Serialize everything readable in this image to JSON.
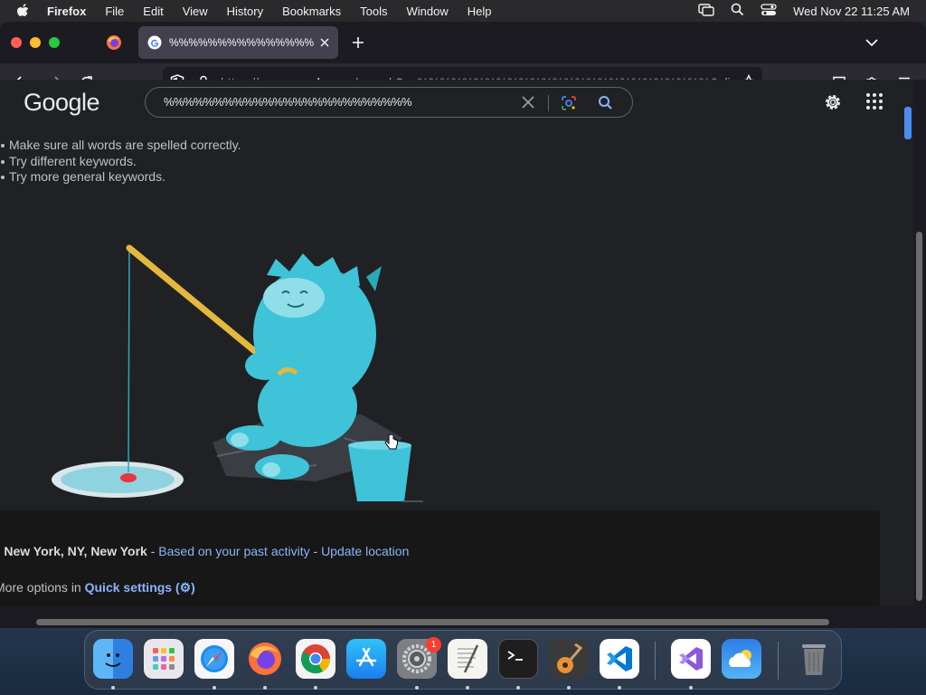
{
  "menubar": {
    "app_name": "Firefox",
    "items": [
      "File",
      "Edit",
      "View",
      "History",
      "Bookmarks",
      "Tools",
      "Window",
      "Help"
    ],
    "datetime": "Wed Nov 22  11:25 AM"
  },
  "browser": {
    "active_tab_title": "%%%%%%%%%%%%%%%%%%%%%%%%%%% -",
    "url_prefix": "https://",
    "url_host": "www.google.com",
    "url_rest": "/search?q=%%%%%%%%%%%%%%%%%%%%%%%%%%&client=firefox-b-1-d&"
  },
  "google": {
    "logo_text": "Google",
    "search_query": "%%%%%%%%%%%%%%%%%%%%%%%%%"
  },
  "tips": [
    "Make sure all words are spelled correctly.",
    "Try different keywords.",
    "Try more general keywords."
  ],
  "footer": {
    "location": "New York, NY, New York",
    "sep1": " - ",
    "past_activity_link": "Based on your past activity",
    "sep2": " - ",
    "update_location_link": "Update location",
    "more_options_text": "More options in ",
    "quick_settings_link": "Quick settings (⚙)"
  },
  "dock": {
    "system_settings_badge": "1"
  },
  "colors": {
    "accent": "#8ab4f8",
    "tab_bg": "#42414d",
    "page_bg": "#202124",
    "illustration_blue": "#3fc3d8"
  }
}
